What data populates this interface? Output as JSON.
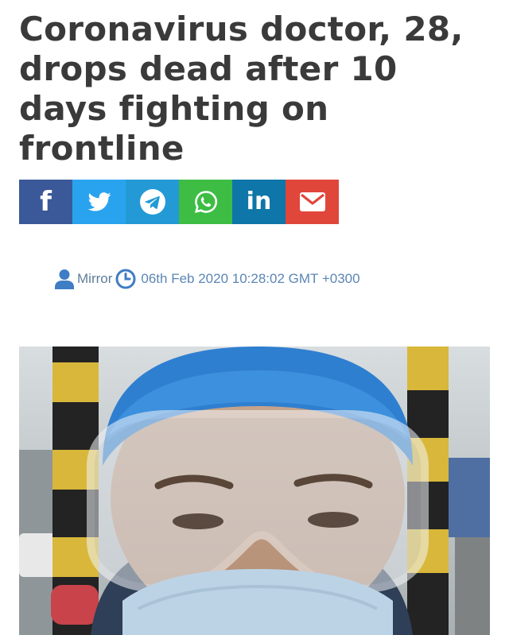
{
  "article": {
    "headline": "Coronavirus doctor, 28, drops dead after 10 days fighting on frontline",
    "author": "Mirror",
    "timestamp": "06th Feb 2020 10:28:02 GMT +0300"
  },
  "share": [
    {
      "name": "facebook",
      "label": "f",
      "color": "#3b5998",
      "icon": "facebook-icon"
    },
    {
      "name": "twitter",
      "color": "#2aa3ef",
      "icon": "twitter-bird-icon"
    },
    {
      "name": "telegram",
      "color": "#239ad6",
      "icon": "telegram-plane-icon"
    },
    {
      "name": "whatsapp",
      "color": "#3dbd44",
      "icon": "whatsapp-phone-icon"
    },
    {
      "name": "linkedin",
      "label": "in",
      "color": "#0e76a8",
      "icon": "linkedin-icon"
    },
    {
      "name": "email",
      "color": "#e1463b",
      "icon": "envelope-icon"
    }
  ],
  "meta_icons": {
    "author": "user-icon",
    "time": "clock-icon",
    "color": "#3f7dc4"
  }
}
